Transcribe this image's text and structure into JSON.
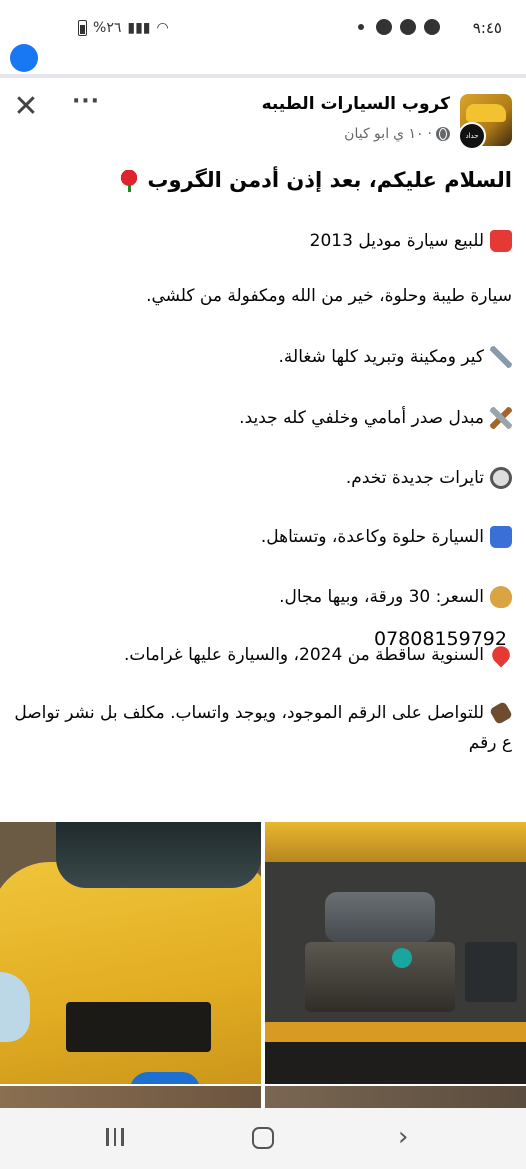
{
  "status_bar": {
    "time": "٩:٤٥",
    "battery": "%٢٦"
  },
  "post": {
    "close_icon": "close-icon",
    "more_icon": "more-options-icon",
    "group_name": "كروب السيارات الطيبه",
    "author": "ابو كيان",
    "time_ago": "١٠ ي",
    "separator": "·",
    "privacy_icon": "globe-icon",
    "user_avatar_text": "حداد",
    "title": "السلام عليكم، بعد إذن أدمن الگروب",
    "paragraphs": [
      "للبيع سيارة موديل 2013",
      "سيارة طيبة وحلوة، خير من الله ومكفولة من كلشي.",
      "كير ومكينة وتبريد كلها شغالة.",
      "مبدل صدر أمامي وخلفي كله جديد.",
      "تايرات جديدة تخدم.",
      "السيارة حلوة وكاعدة، وتستاهل.",
      "السعر: 30 ورقة، وبيها مجال.",
      "السنوية ساقطة من 2024، والسيارة عليها غرامات.",
      "للتواصل على الرقم الموجود، ويوجد واتساب. مكلف بل نشر تواصل  ع رقم"
    ],
    "phone": "07808159792",
    "emoji_names": [
      "rose-emoji",
      "red-car-emoji",
      "wrench-emoji",
      "hammer-wrench-emoji",
      "wheel-emoji",
      "blue-car-emoji",
      "money-bag-emoji",
      "pushpin-emoji",
      "phone-receiver-emoji"
    ]
  },
  "photos": [
    {
      "name": "car-front-photo"
    },
    {
      "name": "engine-bay-photo"
    }
  ],
  "nav_bar": {
    "recent_icon": "recent-apps-icon",
    "home_icon": "home-icon",
    "back_icon": "back-icon"
  }
}
